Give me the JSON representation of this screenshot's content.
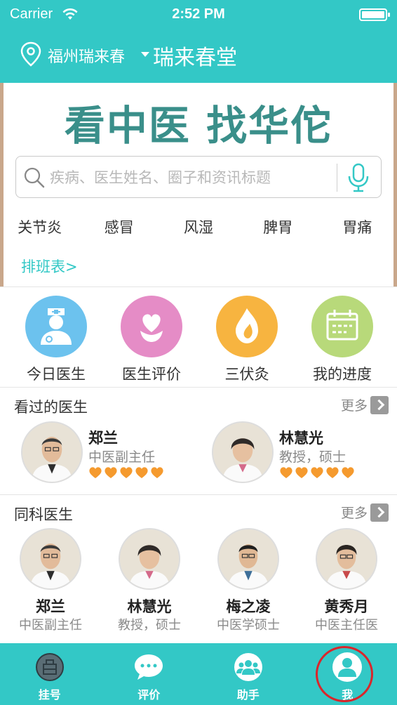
{
  "status": {
    "carrier": "Carrier",
    "time": "2:52 PM"
  },
  "header": {
    "city": "福州瑞来春",
    "hall": "瑞来春堂"
  },
  "banner": {
    "slogan": "看中医 找华佗"
  },
  "search": {
    "placeholder": "疾病、医生姓名、圈子和资讯标题"
  },
  "tags": [
    "关节炎",
    "感冒",
    "风湿",
    "脾胃",
    "胃痛"
  ],
  "schedule_link": "排班表>",
  "features": [
    {
      "label": "今日医生",
      "color": "#6cc2ee",
      "icon": "doctor-icon"
    },
    {
      "label": "医生评价",
      "color": "#e58cc6",
      "icon": "heart-flower-icon"
    },
    {
      "label": "三伏灸",
      "color": "#f7b440",
      "icon": "flame-icon"
    },
    {
      "label": "我的进度",
      "color": "#b8d97a",
      "icon": "calendar-icon"
    }
  ],
  "viewed": {
    "title": "看过的医生",
    "more": "更多",
    "doctors": [
      {
        "name": "郑兰",
        "title": "中医副主任",
        "rating": 5,
        "gender": "male"
      },
      {
        "name": "林慧光",
        "title": "教授，硕士",
        "rating": 5,
        "gender": "female"
      }
    ]
  },
  "colleagues": {
    "title": "同科医生",
    "more": "更多",
    "doctors": [
      {
        "name": "郑兰",
        "title": "中医副主任"
      },
      {
        "name": "林慧光",
        "title": "教授，硕士"
      },
      {
        "name": "梅之凌",
        "title": "中医学硕士"
      },
      {
        "name": "黄秀月",
        "title": "中医主任医"
      }
    ]
  },
  "tabs": [
    {
      "label": "挂号",
      "icon": "register-icon"
    },
    {
      "label": "评价",
      "icon": "chat-icon"
    },
    {
      "label": "助手",
      "icon": "group-icon"
    },
    {
      "label": "我",
      "icon": "user-icon"
    }
  ],
  "colors": {
    "primary": "#33c8c6",
    "slogan": "#3a8f8a",
    "heart": "#f59a2e",
    "ring": "#d9262b"
  }
}
